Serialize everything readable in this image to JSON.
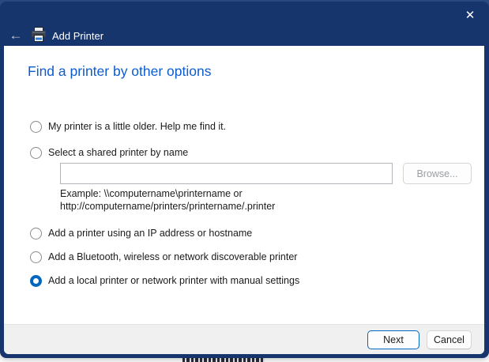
{
  "window": {
    "title": "Add Printer",
    "back_icon": "left-arrow",
    "close_icon": "x"
  },
  "colors": {
    "titlebar_navy": "#17356d",
    "behind_window_navy": "#2a4c86",
    "heading_blue": "#0e5ccc",
    "radio_selected_blue": "#0067c0",
    "next_button_border": "#0067c0",
    "footer_gray": "#f0f0f0"
  },
  "content": {
    "heading": "Find a printer by other options",
    "options": [
      {
        "label": "My printer is a little older. Help me find it.",
        "selected": false
      },
      {
        "label": "Select a shared printer by name",
        "selected": false
      },
      {
        "label": "Add a printer using an IP address or hostname",
        "selected": false
      },
      {
        "label": "Add a Bluetooth, wireless or network discoverable printer",
        "selected": false
      },
      {
        "label": "Add a local printer or network printer with manual settings",
        "selected": true
      }
    ],
    "shared_printer": {
      "input_value": "",
      "browse_label": "Browse...",
      "example_line1": "Example: \\\\computername\\printername or",
      "example_line2": "http://computername/printers/printername/.printer"
    }
  },
  "footer": {
    "next_label": "Next",
    "cancel_label": "Cancel"
  }
}
